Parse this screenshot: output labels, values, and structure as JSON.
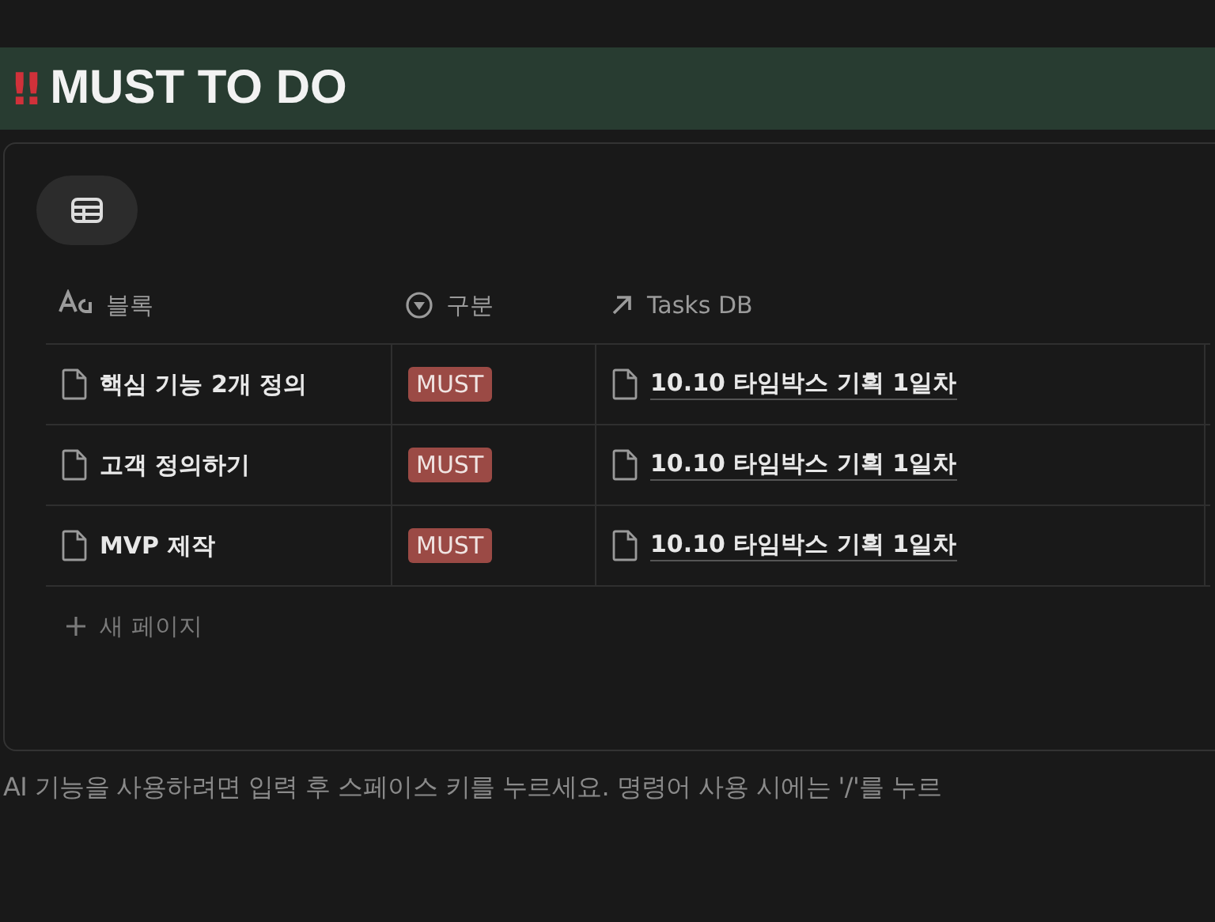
{
  "header": {
    "icon_text": "‼",
    "title": "MUST TO DO"
  },
  "table": {
    "columns": [
      {
        "kind": "title",
        "label": "블록"
      },
      {
        "kind": "select",
        "label": "구분"
      },
      {
        "kind": "relation",
        "label": "Tasks DB"
      }
    ],
    "rows": [
      {
        "name": "핵심 기능 2개 정의",
        "tag": "MUST",
        "color": "#9b4a45",
        "relation": "10.10 타임박스 기획 1일차"
      },
      {
        "name": "고객 정의하기",
        "tag": "MUST",
        "color": "#9b4a45",
        "relation": "10.10 타임박스 기획 1일차"
      },
      {
        "name": "MVP 제작",
        "tag": "MUST",
        "color": "#9b4a45",
        "relation": "10.10 타임박스 기획 1일차"
      }
    ],
    "new_row": "새 페이지"
  },
  "placeholder": "AI 기능을 사용하려면 입력 후 스페이스 키를 누르세요. 명령어 사용 시에는 '/'를 누르"
}
